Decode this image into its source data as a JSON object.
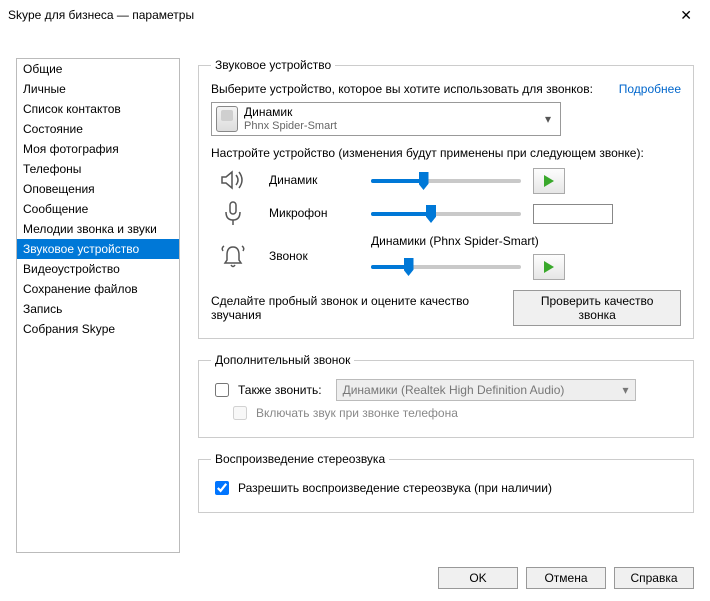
{
  "title": "Skype для бизнеса — параметры",
  "sidebar": {
    "items": [
      {
        "label": "Общие"
      },
      {
        "label": "Личные"
      },
      {
        "label": "Список контактов"
      },
      {
        "label": "Состояние"
      },
      {
        "label": "Моя фотография"
      },
      {
        "label": "Телефоны"
      },
      {
        "label": "Оповещения"
      },
      {
        "label": "Сообщение"
      },
      {
        "label": "Мелодии звонка и звуки"
      },
      {
        "label": "Звуковое устройство"
      },
      {
        "label": "Видеоустройство"
      },
      {
        "label": "Сохранение файлов"
      },
      {
        "label": "Запись"
      },
      {
        "label": "Собрания Skype"
      }
    ],
    "selected_index": 9
  },
  "panel": {
    "audio_device": {
      "legend": "Звуковое устройство",
      "select_label": "Выберите устройство, которое вы хотите использовать для звонков:",
      "more_link": "Подробнее",
      "device": {
        "name": "Динамик",
        "sub": "Phnx Spider-Smart"
      },
      "tune_label": "Настройте устройство (изменения будут применены при следующем звонке):",
      "speaker": {
        "title": "Динамик",
        "pct": 35
      },
      "mic": {
        "title": "Микрофон",
        "pct": 40
      },
      "ringer": {
        "title": "Звонок",
        "value_label": "Динамики (Phnx Spider-Smart)",
        "pct": 25
      },
      "test_text": "Сделайте пробный звонок и оцените качество звучания",
      "test_btn": "Проверить качество звонка"
    },
    "secondary": {
      "legend": "Дополнительный звонок",
      "also_ring": "Также звонить:",
      "also_ring_value": "Динамики (Realtek High Definition Audio)",
      "unmute_label": "Включать звук при звонке телефона"
    },
    "stereo": {
      "legend": "Воспроизведение стереозвука",
      "allow_label": "Разрешить воспроизведение стереозвука (при наличии)"
    }
  },
  "buttons": {
    "ok": "OK",
    "cancel": "Отмена",
    "help": "Справка"
  }
}
